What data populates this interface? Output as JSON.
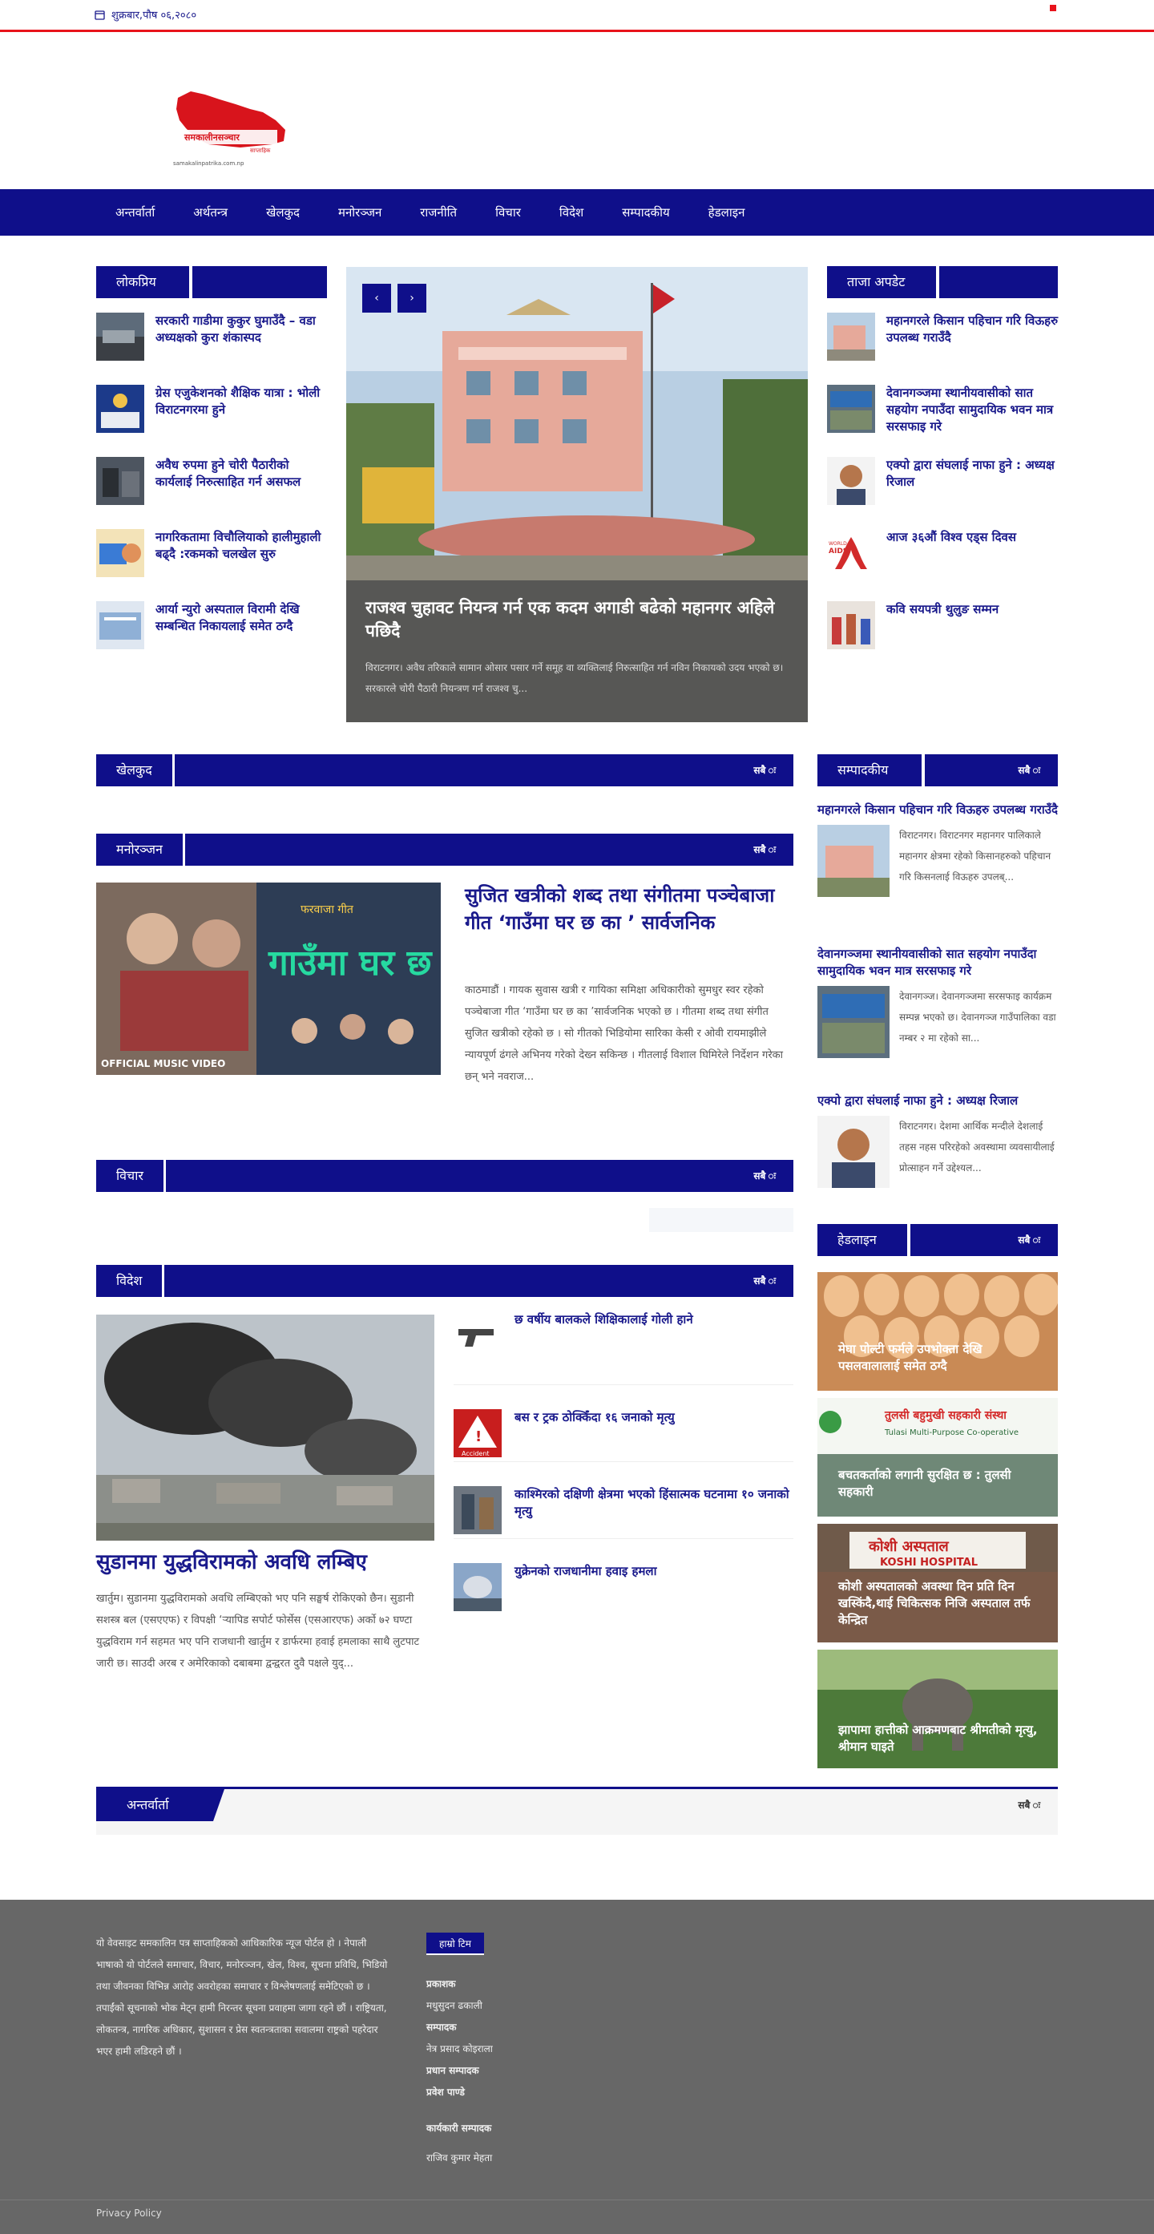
{
  "topbar": {
    "date": "शुक्रबार,पौष ०६,२०८०"
  },
  "logo": {
    "brand": "समकालीनसञ्चार",
    "tagline": "साप्ताहिक",
    "url": "samakalinpatrika.com.np"
  },
  "nav": [
    "अन्तर्वार्ता",
    "अर्थतन्त्र",
    "खेलकुद",
    "मनोरञ्जन",
    "राजनीति",
    "विचार",
    "विदेश",
    "सम्पादकीय",
    "हेडलाइन"
  ],
  "lokpriya": {
    "label": "लोकप्रिय",
    "items": [
      "सरकारी गाडीमा कुकुर घुमाउँदै – वडा अध्यक्षको कुरा शंकास्पद",
      "ग्रेस एजुकेशनको शैक्षिक यात्रा : भोली विराटनगरमा हुने",
      "अवैध रुपमा हुने चोरी पैठारीको कार्यलाई निरुत्साहित गर्न असफल",
      "नागरिकतामा विचौलियाको हालीमुहाली बढ्दै :रकमको चलखेल सुरु",
      "आर्या न्युरो अस्पताल विरामी देखि सम्बन्धित निकायलाई समेत ठग्दै"
    ]
  },
  "slider": {
    "title": "राजश्व चुहावट नियन्त्र गर्न एक कदम अगाडी बढेको महानगर अहिले पछिदै",
    "text": "विराटनगर। अवैध तरिकाले सामान ओसार पसार गर्ने समूह वा व्यक्तिलाई निरुत्साहित गर्न नविन निकायको उदय भएको छ। सरकारले चोरी पैठारी नियन्त्रण गर्न राजश्व चु..."
  },
  "taja": {
    "label": "ताजा अपडेट",
    "items": [
      "महानगरले किसान पहिचान गरि विऊहरु उपलब्ध गराउँदै",
      "देवानगञ्जमा स्थानीयवासीको सात सहयोग नपाउँदा सामुदायिक भवन मात्र सरसफाइ गरे",
      "एक्पो द्वारा संघलाई नाफा हुने : अध्यक्ष रिजाल",
      "आज ३६औं विश्व एड्स दिवस",
      "कवि सयपत्री थुलुङ सम्मन"
    ]
  },
  "sections": {
    "all_label": "सबै ः",
    "khelkud": "खेलकुद",
    "manoranjan": "मनोरञ्जन",
    "bichar": "विचार",
    "bidesh": "विदेश",
    "sampadakiya": "सम्पादकीय",
    "headline": "हेडलाइन",
    "antarbarta": "अन्तर्वार्ता"
  },
  "manoranjan_story": {
    "poster_title": "गाउँमा घर छ का",
    "poster_top": "फरवाजा गीत",
    "poster_badge": "OFFICIAL MUSIC VIDEO",
    "title": "सुजित खत्रीको शब्द तथा संगीतमा पञ्चेबाजा गीत ‘गाउँमा घर छ का ’ सार्वजनिक",
    "text": "काठमाडौं । गायक सुवास खत्री र गायिका समिक्षा अधिकारीको सुमधुर स्वर रहेको पञ्चेबाजा गीत ‘गाउँमा घर छ का ’सार्वजनिक भएको छ । गीतमा शब्द तथा संगीत सुजित खत्रीको रहेको छ । सो गीतको भिडियोमा सारिका केसी र ओवी रायमाझीले न्यायपूर्ण ढंगले अभिनय गरेको देख्न सकिन्छ । गीतलाई विशाल घिमिरेले निर्देशन गरेका छन् भने नवराज..."
  },
  "bidesh_story": {
    "title": "सुडानमा युद्धविरामको अवधि लम्बिए",
    "text": "खार्तुम। सुडानमा युद्धविरामको अवधि लम्बिएको भए पनि सङ्घर्ष रोकिएको छैन। सुडानी सशस्त्र बल (एसएएफ) र विपक्षी ‘र्‍यापिड सपोर्ट फोर्सेस (एसआरएफ) अर्को ७२ घण्टा युद्धविराम गर्न सहमत भए पनि राजधानी खार्तुम र डार्फरमा हवाई हमलाका साथै लुटपाट जारी छ। साउदी अरब र अमेरिकाको दबाबमा द्वन्द्वरत दुवै पक्षले युद्...",
    "side": [
      "छ वर्षीय बालकले शिक्षिकालाई गोली हाने",
      "बस र ट्रक ठोक्किँदा १६ जनाको मृत्यु",
      "काश्मिरको दक्षिणी क्षेत्रमा भएको हिंसात्मक घटनामा १० जनाको मृत्यु",
      "युक्रेनको राजधानीमा हवाइ हमला"
    ]
  },
  "sampadakiya_items": [
    {
      "title": "महानगरले किसान पहिचान गरि विऊहरु उपलब्ध गराउँदै",
      "text": "विराटनगर। विराटनगर महानगर पालिकाले महानगर क्षेत्रमा रहेको किसानहरुको पहिचान गरि किसनलाई विऊहरु उपलब्..."
    },
    {
      "title": "देवानगञ्जमा स्थानीयवासीको सात सहयोग नपाउँदा सामुदायिक भवन मात्र सरसफाइ गरे",
      "text": "देवानगञ्ज। देवानगञ्जमा सरसफाइ कार्यक्रम सम्पन्न भएको छ। देवानगञ्ज गाउँपालिका वडा नम्बर २ मा रहेको सा..."
    },
    {
      "title": "एक्पो द्वारा संघलाई नाफा हुने : अध्यक्ष रिजाल",
      "text": "विराटनगर। देशमा आर्थिक मन्दीले देशलाई तहस नहस परिरहेको अवस्थामा व्यवसायीलाई प्रोत्साहन गर्ने उद्देश्यल..."
    }
  ],
  "headline_items": [
    "मेघा पोल्टी फर्मले उपभोक्ता देखि पसलवालालाई समेत ठग्दै",
    "बचतकर्ताको लगानी सुरक्षित छ : तुलसी सहकारी",
    "कोशी अस्पतालको अवस्था दिन प्रति दिन खस्किंदै,थाई चिकित्सक निजि अस्पताल तर्फ केन्द्रित",
    "झापामा हात्तीको आक्रमणबाट श्रीमतीको मृत्यु, श्रीमान घाइते"
  ],
  "tulasi": {
    "line1": "तुलसी बहुमुखी सहकारी संस्था",
    "line2": "Tulasi Multi-Purpose Co-operative"
  },
  "koshi": {
    "np": "कोशी अस्पताल",
    "en": "KOSHI HOSPITAL"
  },
  "aids": {
    "world": "WORLD",
    "aids": "AIDS"
  },
  "accident": "Accident",
  "footer": {
    "about": "यो वेवसाइट समकालिन पत्र साप्ताहिकको आधिकारिक न्यूज पोर्टल हो । नेपाली भाषाको यो पोर्टलले समाचार, विचार, मनोरञ्जन, खेल, विश्व, सूचना प्रविधि, भिडियो तथा जीवनका विभिन्न आरोह अवरोहका समाचार र विश्लेषणलाई समेटिएको छ । तपाईंको सूचनाको भोक मेट्न हामी निरन्तर सूचना प्रवाहमा जागा रहने छौं । राष्ट्रियता, लोकतन्त्र, नागरिक अधिकार, सुशासन र प्रेस स्वतन्त्रताका सवालमा राष्ट्रको पहरेदार भएर हामी लडिरहने छौं ।",
    "team_label": "हाम्रो टिम",
    "team": [
      {
        "role": "प्रकाशक",
        "name": "मधुसुदन ढकाली"
      },
      {
        "role": "सम्पादक",
        "name": "नेत्र प्रसाद कोइराला"
      },
      {
        "role": "प्रधान सम्पादक",
        "name": "प्रवेश पाण्डे"
      },
      {
        "role": "कार्यकारी सम्पादक",
        "name": "राजिव कुमार मेहता"
      }
    ],
    "privacy": "Privacy Policy"
  }
}
